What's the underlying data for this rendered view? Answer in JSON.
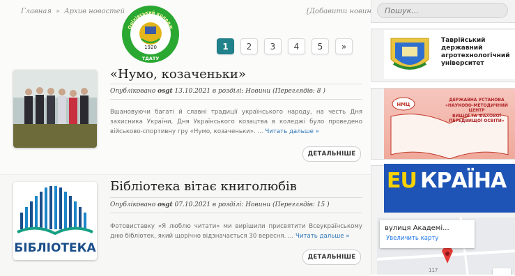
{
  "breadcrumbs": [
    "Главная",
    "Архив новостей"
  ],
  "breadcrumb_separator": "»",
  "add_news": "[Добавити новину]",
  "logo": {
    "arc_text": "Оріхівський коледж",
    "year": "1920",
    "abbr": "ТДАТУ",
    "colors": {
      "ring": "#2aa832",
      "inner": "#ffffff",
      "emblem": "#e3b51b"
    }
  },
  "pagination": {
    "pages": [
      "1",
      "2",
      "3",
      "4",
      "5"
    ],
    "next": "»",
    "current": "1",
    "active_color": "#21828b"
  },
  "articles": [
    {
      "title": "«Нумо, козаченьки»",
      "meta_prefix": "Опубліковано",
      "author": "osgt",
      "meta_suffix": "13.10.2021 в розділі: Новини (Переглядів: 8 )",
      "excerpt": "Вшановуючи багаті й славні традиції українського народу, на честь Дня захисника України, Дня Українського козацтва в коледжі було проведено військово-спортивну гру «Нумо, козаченьки». ...",
      "read_more": "Читать дальше »",
      "button": "ДЕТАЛЬНІШЕ",
      "thumb_icon": "group-photo"
    },
    {
      "title": "Бібліотека вітає книголюбів",
      "meta_prefix": "Опубліковано",
      "author": "osgt",
      "meta_suffix": "07.10.2021 в розділі: Новини (Переглядів: 15 )",
      "excerpt": "Фотовиставку «Я люблю читати» ми вирішили присвятити Всеукраїнському дню бібліотек, який щорічно відзначається 30 вересня. ...",
      "read_more": "Читать дальше »",
      "button": "ДЕТАЛЬНІШЕ",
      "thumb_label": "БІБЛІОТЕКА",
      "thumb_icon": "library-logo"
    }
  ],
  "sidebar": {
    "search_placeholder": "Пошук...",
    "banner1": {
      "line1": "Таврійський",
      "line2": "державний",
      "line3": "агротехнологічний",
      "line4": "університет"
    },
    "banner2": {
      "line1": "ДЕРЖАВНА УСТАНОВА",
      "line2": "«НАУКОВО-МЕТОДИЧНИЙ ЦЕНТР",
      "line3": "ВИЩОЇ ТА ФАХОВОЇ ПЕРЕДВИЩОЇ ОСВІТИ»",
      "logo": "НМЦ"
    },
    "banner3": {
      "eu": "EU",
      "ua": "КРАЇНА",
      "color": "#1e54b5",
      "eu_color": "#f6d200"
    },
    "map": {
      "name": "вулиця Академі...",
      "link": "Увеличить карту",
      "number": "117"
    }
  }
}
